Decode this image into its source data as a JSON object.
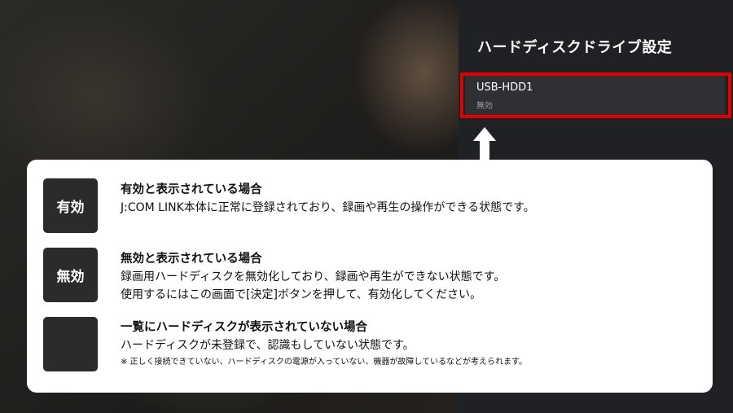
{
  "settings_panel": {
    "title": "ハードディスクドライブ設定",
    "devices": [
      {
        "name": "USB-HDD1",
        "status": "無効"
      }
    ]
  },
  "colors": {
    "highlight": "#e50000",
    "panel_bg": "#202124",
    "badge_bg": "#2b2b2b"
  },
  "help": {
    "items": [
      {
        "badge": "有効",
        "heading": "有効と表示されている場合",
        "lines": [
          "J:COM LINK本体に正常に登録されており、録画や再生の操作ができる状態です。"
        ]
      },
      {
        "badge": "無効",
        "heading": "無効と表示されている場合",
        "lines": [
          "録画用ハードディスクを無効化しており、録画や再生ができない状態です。",
          "使用するにはこの画面で[決定]ボタンを押して、有効化してください。"
        ]
      },
      {
        "badge": "",
        "heading": "一覧にハードディスクが表示されていない場合",
        "lines": [
          "ハードディスクが未登録で、認識もしていない状態です。"
        ],
        "note": "※ 正しく接続できていない、ハードディスクの電源が入っていない、機器が故障しているなどが考えられます。"
      }
    ]
  }
}
